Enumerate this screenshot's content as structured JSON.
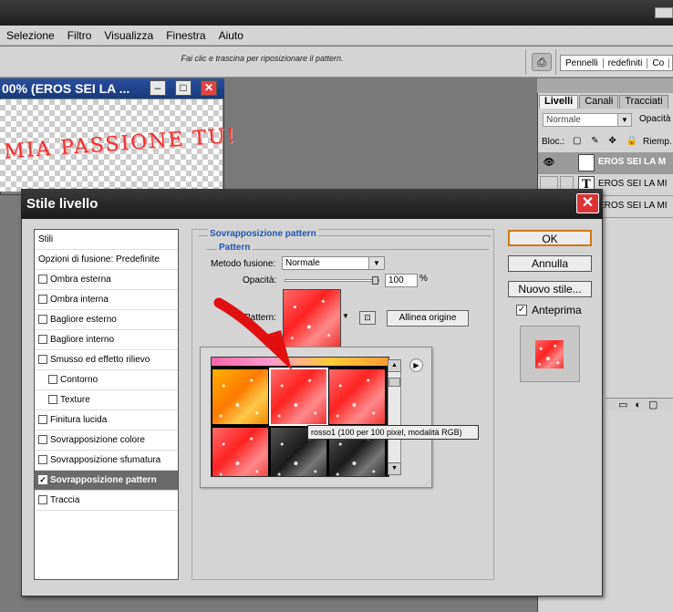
{
  "menu": [
    "Selezione",
    "Filtro",
    "Visualizza",
    "Finestra",
    "Aiuto"
  ],
  "options": {
    "hint": "Fai clic e trascina per riposizionare il pattern.",
    "presets": [
      "Pennelli",
      "redefiniti",
      "Co"
    ],
    "stamp_icon": "stamp-icon"
  },
  "document": {
    "title": "00% (EROS SEI LA ...",
    "canvas_text": "MIA PASSIONE TU!"
  },
  "window_controls": {
    "min_icon": "–",
    "max_icon": "□",
    "close_icon": "✕"
  },
  "layers": {
    "tabs": [
      "Livelli",
      "Canali",
      "Tracciati"
    ],
    "blend_mode": "Normale",
    "opacity_label": "Opacità",
    "lock_label": "Bloc.:",
    "fill_label": "Riemp.",
    "items": [
      {
        "name": "EROS SEI LA M",
        "selected": true
      },
      {
        "name": "EROS SEI LA MI",
        "selected": false
      },
      {
        "name": "EROS SEI LA MI",
        "selected": false
      }
    ]
  },
  "dialog": {
    "title": "Stile livello",
    "styles": [
      {
        "label": "Stili",
        "checkbox": false,
        "sub": false,
        "selected": false,
        "checked": false
      },
      {
        "label": "Opzioni di fusione: Predefinite",
        "checkbox": false,
        "sub": false,
        "selected": false,
        "checked": false
      },
      {
        "label": "Ombra esterna",
        "checkbox": true,
        "sub": false,
        "selected": false,
        "checked": false
      },
      {
        "label": "Ombra interna",
        "checkbox": true,
        "sub": false,
        "selected": false,
        "checked": false
      },
      {
        "label": "Bagliore esterno",
        "checkbox": true,
        "sub": false,
        "selected": false,
        "checked": false
      },
      {
        "label": "Bagliore interno",
        "checkbox": true,
        "sub": false,
        "selected": false,
        "checked": false
      },
      {
        "label": "Smusso ed effetto rilievo",
        "checkbox": true,
        "sub": false,
        "selected": false,
        "checked": false
      },
      {
        "label": "Contorno",
        "checkbox": true,
        "sub": true,
        "selected": false,
        "checked": false
      },
      {
        "label": "Texture",
        "checkbox": true,
        "sub": true,
        "selected": false,
        "checked": false
      },
      {
        "label": "Finitura lucida",
        "checkbox": true,
        "sub": false,
        "selected": false,
        "checked": false
      },
      {
        "label": "Sovrapposizione colore",
        "checkbox": true,
        "sub": false,
        "selected": false,
        "checked": false
      },
      {
        "label": "Sovrapposizione sfumatura",
        "checkbox": true,
        "sub": false,
        "selected": false,
        "checked": false
      },
      {
        "label": "Sovrapposizione pattern",
        "checkbox": true,
        "sub": false,
        "selected": true,
        "checked": true
      },
      {
        "label": "Traccia",
        "checkbox": true,
        "sub": false,
        "selected": false,
        "checked": false
      }
    ],
    "group_title": "Sovrapposizione pattern",
    "sub_title": "Pattern",
    "blend_label": "Metodo fusione:",
    "blend_value": "Normale",
    "opacity_label": "Opacità:",
    "opacity_value": "100",
    "percent": "%",
    "pattern_label": "Pattern:",
    "align_button": "Allinea origine",
    "tooltip": "rosso1 (100 per 100 pixel, modalità RGB)",
    "buttons": {
      "ok": "OK",
      "cancel": "Annulla",
      "new_style": "Nuovo stile..."
    },
    "preview_label": "Anteprima",
    "preview_checked": true
  },
  "colors": {
    "accent": "#2255aa"
  }
}
